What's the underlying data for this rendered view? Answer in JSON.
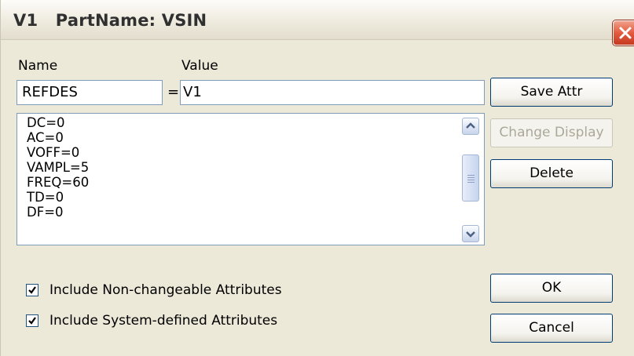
{
  "window": {
    "title": "V1   PartName: VSIN"
  },
  "labels": {
    "name": "Name",
    "value": "Value",
    "equals": "="
  },
  "inputs": {
    "name_value": "REFDES",
    "value_value": "V1"
  },
  "attributes": [
    "DC=0",
    "AC=0",
    "VOFF=0",
    "VAMPL=5",
    "FREQ=60",
    "TD=0",
    "DF=0"
  ],
  "buttons": {
    "save_attr": "Save Attr",
    "change_display": "Change Display",
    "delete": "Delete",
    "ok": "OK",
    "cancel": "Cancel"
  },
  "checkboxes": {
    "non_changeable": {
      "label": "Include Non-changeable Attributes",
      "checked": true
    },
    "system_defined": {
      "label": "Include System-defined Attributes",
      "checked": true
    }
  },
  "icons": {
    "close": "close-icon",
    "scroll_up": "chevron-up-icon",
    "scroll_down": "chevron-down-icon",
    "check": "check-icon"
  }
}
